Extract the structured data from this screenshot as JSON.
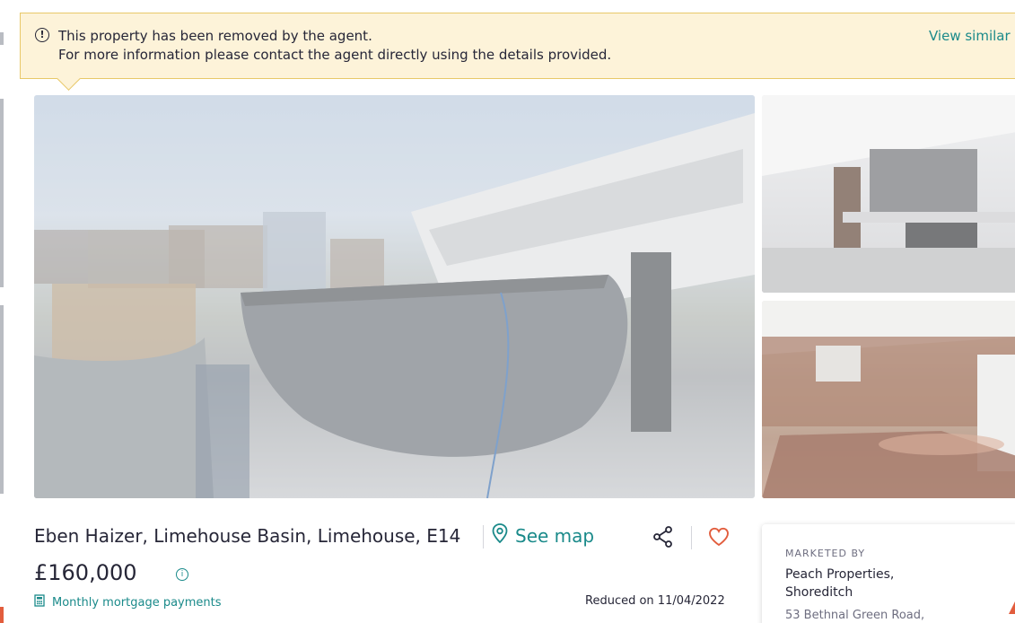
{
  "notice": {
    "icon": "info-circle-icon",
    "line1": "This property has been removed by the agent.",
    "line2": "For more information please contact the agent directly using the details provided.",
    "link": "View similar"
  },
  "gallery": {
    "main_photo": "boat-exterior-photo",
    "side_photos": [
      "kitchen-interior-photo",
      "wood-paneled-cabin-photo"
    ]
  },
  "listing": {
    "address": "Eben Haizer, Limehouse Basin, Limehouse, E14",
    "see_map": "See map",
    "price": "£160,000",
    "mortgage_link": "Monthly mortgage payments",
    "reduced": "Reduced on 11/04/2022"
  },
  "agent": {
    "label": "MARKETED BY",
    "name": "Peach Properties, Shoreditch",
    "address": "53 Bethnal Green Road,"
  },
  "colors": {
    "accent": "#1a8a8a",
    "notice_bg": "#fdf3d9",
    "notice_border": "#e8c869",
    "text": "#262637",
    "favourite": "#e25d3d"
  }
}
